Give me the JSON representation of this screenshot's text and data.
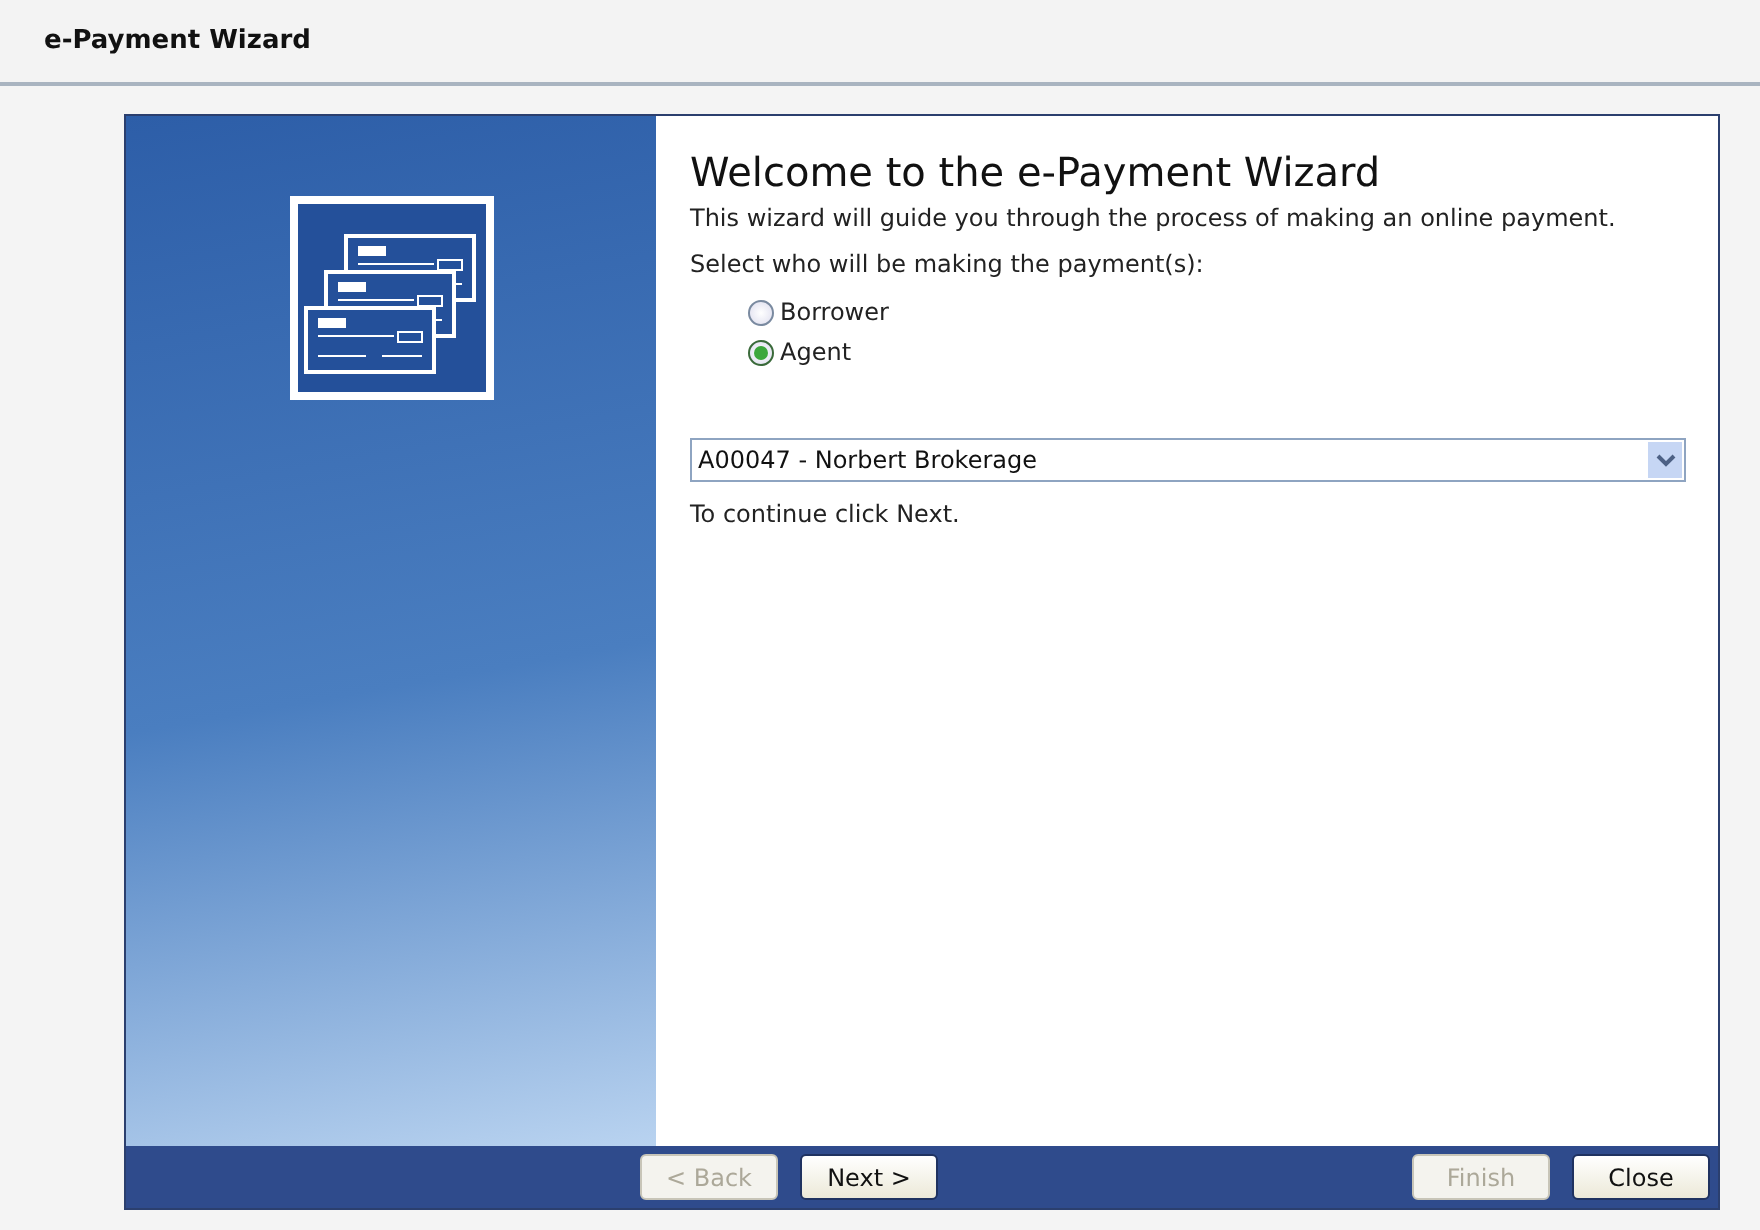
{
  "window": {
    "title": "e-Payment Wizard"
  },
  "wizard": {
    "heading": "Welcome to the e-Payment Wizard",
    "intro": "This wizard will guide you through the process of making an online payment.",
    "prompt": "Select who will be making the payment(s):",
    "payers": [
      {
        "label": "Borrower",
        "selected": false
      },
      {
        "label": "Agent",
        "selected": true
      }
    ],
    "agent_select": {
      "value": "A00047 - Norbert Brokerage"
    },
    "hint": "To continue click Next."
  },
  "buttons": [
    {
      "label": "< Back",
      "disabled": true
    },
    {
      "label": "Next >",
      "disabled": false
    },
    {
      "label": "Finish",
      "disabled": true
    },
    {
      "label": "Close",
      "disabled": false
    }
  ]
}
